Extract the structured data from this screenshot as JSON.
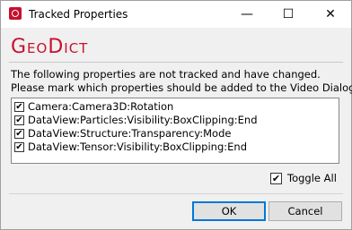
{
  "window": {
    "title": "Tracked Properties",
    "minimize_glyph": "—",
    "maximize_glyph": "☐",
    "close_glyph": "✕"
  },
  "logo": {
    "text": "GeoDict"
  },
  "message": {
    "line1": "The following properties are not tracked and have changed.",
    "line2": "Please mark which properties should be added to the Video Dialog."
  },
  "properties": [
    {
      "label": "Camera:Camera3D:Rotation",
      "checked": true
    },
    {
      "label": "DataView:Particles:Visibility:BoxClipping:End",
      "checked": true
    },
    {
      "label": "DataView:Structure:Transparency:Mode",
      "checked": true
    },
    {
      "label": "DataView:Tensor:Visibility:BoxClipping:End",
      "checked": true
    }
  ],
  "check_glyph": "✔",
  "toggle_all": {
    "label": "Toggle All",
    "checked": true
  },
  "buttons": {
    "ok": "OK",
    "cancel": "Cancel"
  },
  "colors": {
    "brand": "#c8102e",
    "focus": "#0078d7"
  }
}
